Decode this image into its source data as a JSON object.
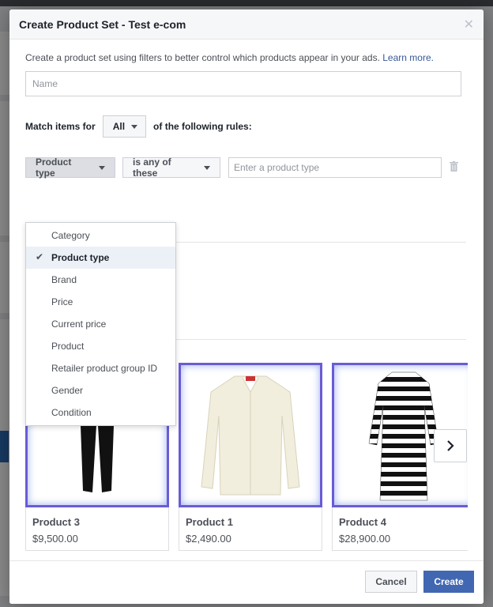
{
  "modal": {
    "title": "Create Product Set - Test e-com",
    "close_icon": "close-icon"
  },
  "intro": {
    "text": "Create a product set using filters to better control which products appear in your ads.",
    "link": "Learn more."
  },
  "name_input": {
    "placeholder": "Name"
  },
  "match": {
    "prefix": "Match items for",
    "value": "All",
    "suffix": "of the following rules:"
  },
  "rule": {
    "field": "Product type",
    "operator": "is any of these",
    "value_placeholder": "Enter a product type"
  },
  "dropdown": {
    "items": [
      {
        "label": "Category",
        "selected": false
      },
      {
        "label": "Product type",
        "selected": true
      },
      {
        "label": "Brand",
        "selected": false
      },
      {
        "label": "Price",
        "selected": false
      },
      {
        "label": "Current price",
        "selected": false
      },
      {
        "label": "Product",
        "selected": false
      },
      {
        "label": "Retailer product group ID",
        "selected": false
      },
      {
        "label": "Gender",
        "selected": false
      },
      {
        "label": "Condition",
        "selected": false
      }
    ]
  },
  "products": [
    {
      "name": "Product 3",
      "price": "$9,500.00",
      "image": "black-pants"
    },
    {
      "name": "Product 1",
      "price": "$2,490.00",
      "image": "cream-cardigan"
    },
    {
      "name": "Product 4",
      "price": "$28,900.00",
      "image": "striped-dress"
    }
  ],
  "footer": {
    "cancel": "Cancel",
    "create": "Create"
  },
  "colors": {
    "primary": "#4267b2",
    "link": "#365899",
    "image_border": "#6a5bd6"
  }
}
